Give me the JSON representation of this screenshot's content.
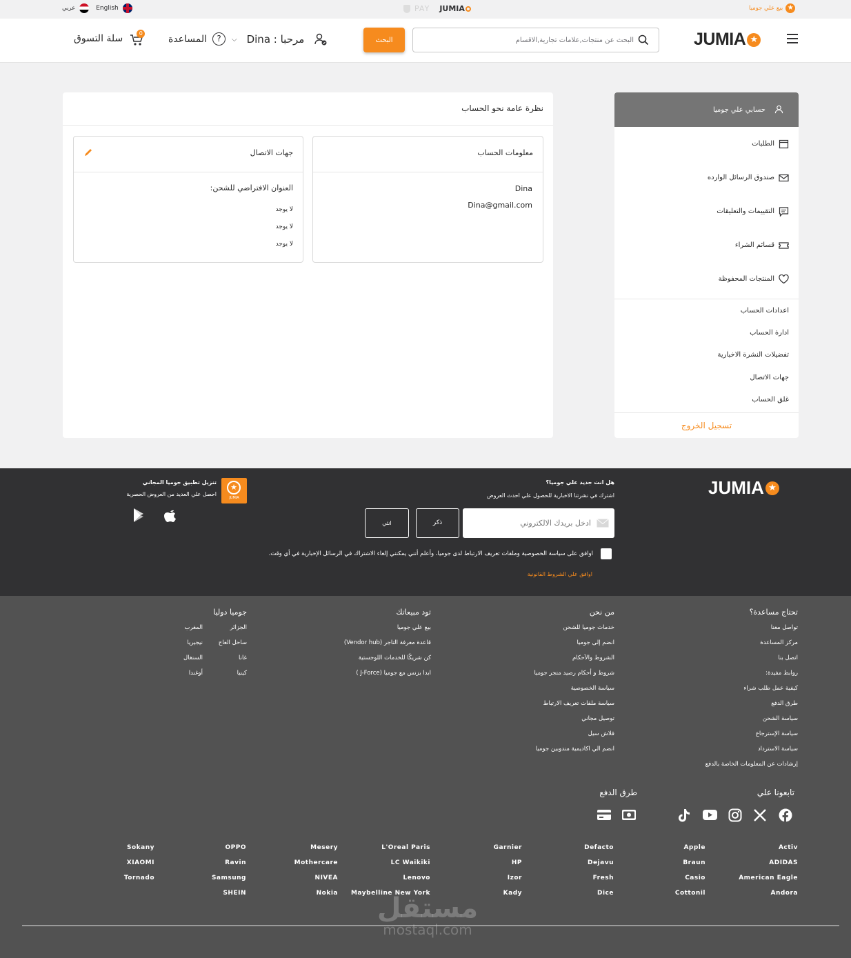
{
  "topbar": {
    "sell_label": "بيع علي جوميا",
    "logo_text": "JUMIA",
    "pay_text": "PAY",
    "lang_english": "English",
    "lang_arabic": "عربي"
  },
  "header": {
    "logo_text": "JUMIA",
    "search_placeholder": "البحث عن منتجات,علامات تجارية,الاقسام",
    "search_button": "البحث",
    "greeting": "مرحبا : Dina",
    "help_label": "المساعدة",
    "cart_label": "سلة التسوق",
    "cart_count": "0"
  },
  "sidebar": {
    "header_label": "حسابي علي جوميا",
    "items": [
      {
        "label": "الطلبات",
        "icon": "box-icon"
      },
      {
        "label": "صندوق الرسائل الوارده",
        "icon": "envelope-icon"
      },
      {
        "label": "التقييمات والتعليقات",
        "icon": "comment-icon"
      },
      {
        "label": "قسائم الشراء",
        "icon": "voucher-icon"
      },
      {
        "label": "المنتجات المحفوظة",
        "icon": "heart-icon"
      }
    ],
    "settings": [
      "اعدادات الحساب",
      "ادارة الحساب",
      "تفضيلات النشرة الاخبارية",
      "جهات الاتصال",
      "غلق الحساب"
    ],
    "logout_label": "تسجيل الخروج"
  },
  "main": {
    "title": "نظرة عامة نحو الحساب",
    "account_card": {
      "title": "معلومات الحساب",
      "name": "Dina",
      "email": "Dina@gmail.com"
    },
    "contacts_card": {
      "title": "جهات الاتصال",
      "subtitle": "العنوان الافتراضي للشحن:",
      "lines": [
        "لا يوجد",
        "لا يوجد",
        "لا يوجد"
      ]
    }
  },
  "footer_top": {
    "logo_text": "JUMIA",
    "newsletter_q": "هل انت جديد علي جوميا؟",
    "newsletter_sub": "اشترك في نشرتنا الاخبارية للحصول علي احدث العروض",
    "email_placeholder": "ادخل بريدك الالكتروني",
    "male_button": "ذكر",
    "female_button": "انثي",
    "consent_text": "اوافق على سياسة الخصوصية وملفات تعريف الارتباط لدى جوميا، وأعلم أنني يمكنني إلغاء الاشتراك في الرسائل الإخبارية في أي وقت.",
    "terms_link": "اوافق علي الشروط القانونية",
    "app_title": "تنزيل تطبيق جوميا المجاني",
    "app_sub": "احصل علي العديد من العروض الحصرية",
    "app_badge": "JUMIA"
  },
  "footer_links": {
    "help": {
      "title": "تحتاج مساعدة؟",
      "links": [
        "تواصل معنا",
        "مركز المساعدة",
        "اتصل بنا",
        "روابط مفيدة:",
        "كيفية عمل طلب شراء",
        "طرق الدفع",
        "سياسة الشحن",
        "سياسة الإسترجاع",
        "سياسة الاسترداد",
        "إرشادات عن المعلومات الخاصة بالدفع"
      ]
    },
    "about": {
      "title": "من نحن",
      "links": [
        "خدمات جوميا للشحن",
        "انضم إلى جوميا",
        "الشروط والأحكام",
        "شروط و أحكام رصيد متجر جوميا",
        "سياسة الخصوصية",
        "سياسة ملفات تعريف الارتباط",
        "توصيل مجاني",
        "فلاش سيل",
        "انضم الي اكاديمية مندوبين جوميا"
      ]
    },
    "sell": {
      "title": "تود مبيعاتك",
      "links": [
        "بيع علي جوميا",
        "قاعدة معرفة التاجر (Vendor hub)",
        "كن شريكًا للخدمات اللوجستية",
        "ابدا بزنس مع جوميا (J-Force )"
      ]
    },
    "intl": {
      "title": "جوميا دوليا",
      "col1": [
        "الجزائر",
        "ساحل العاج",
        "غانا",
        "كينيا"
      ],
      "col2": [
        "المغرب",
        "نيجيريا",
        "السنغال",
        "أوغندا"
      ]
    },
    "follow_title": "تابعونا علي",
    "social_icons": [
      "facebook-icon",
      "x-icon",
      "instagram-icon",
      "youtube-icon",
      "tiktok-icon"
    ],
    "payment_title": "طرق الدفع",
    "payment_icons": [
      "card-icon",
      "cash-icon"
    ]
  },
  "brands": [
    [
      "Activ",
      "ADIDAS",
      "American Eagle",
      "Andora"
    ],
    [
      "Apple",
      "Braun",
      "Casio",
      "Cottonil"
    ],
    [
      "Defacto",
      "Dejavu",
      "Fresh",
      "Dice"
    ],
    [
      "Garnier",
      "HP",
      "Izor",
      "Kady"
    ],
    [
      "L'Oreal Paris",
      "LC Waikiki",
      "Lenovo",
      "Maybelline New York"
    ],
    [
      "Mesery",
      "Mothercare",
      "NIVEA",
      "Nokia"
    ],
    [
      "OPPO",
      "Ravin",
      "Samsung",
      "SHEIN"
    ],
    [
      "Sokany",
      "XIAOMI",
      "Tornado"
    ]
  ],
  "watermark": {
    "arabic": "مستقل",
    "latin": "mostaql.com"
  },
  "colors": {
    "accent": "#f68b1e",
    "footer_dark": "#313133",
    "footer_mid": "#525252",
    "sidebar_header": "#757575"
  }
}
